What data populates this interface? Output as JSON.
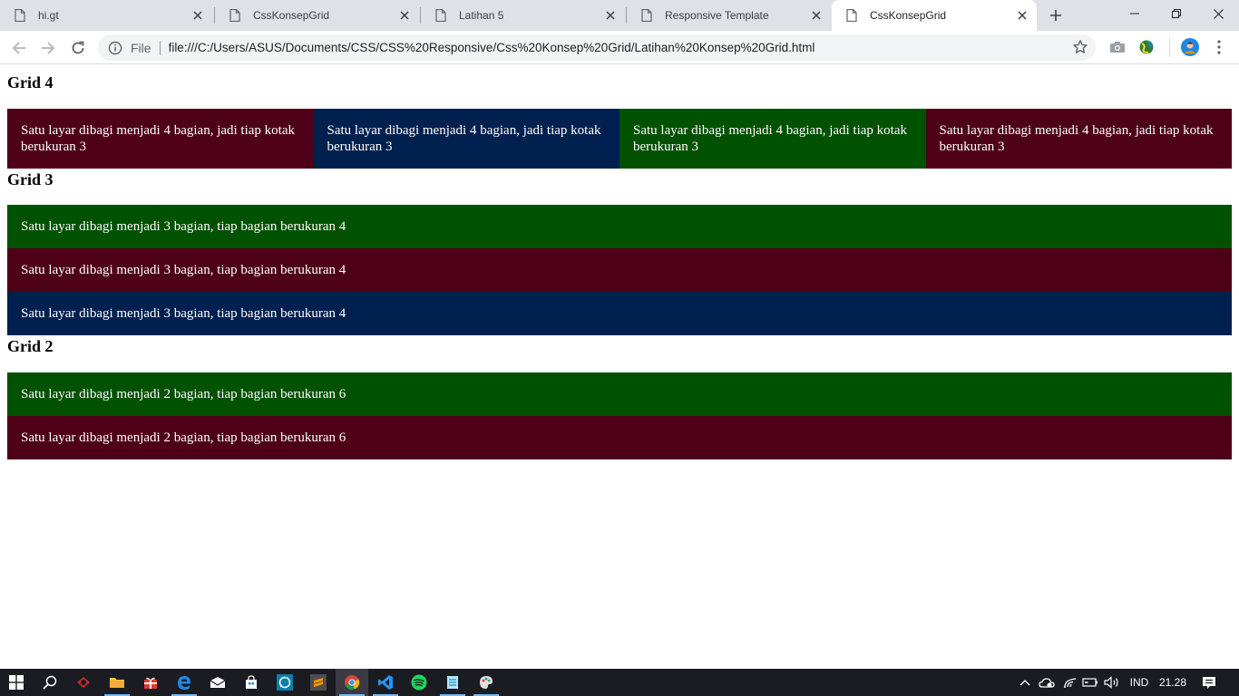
{
  "tabs": [
    {
      "label": "hi.gt",
      "active": false
    },
    {
      "label": "CssKonsepGrid",
      "active": false
    },
    {
      "label": "Latihan 5",
      "active": false
    },
    {
      "label": "Responsive Template",
      "active": false
    },
    {
      "label": "CssKonsepGrid",
      "active": true
    }
  ],
  "omnibox": {
    "scheme": "File",
    "url": "file:///C:/Users/ASUS/Documents/CSS/CSS%20Responsive/Css%20Konsep%20Grid/Latihan%20Konsep%20Grid.html"
  },
  "page": {
    "grid4": {
      "heading": "Grid 4",
      "cells": [
        {
          "text": "Satu layar dibagi menjadi 4 bagian, jadi tiap kotak berukuran 3",
          "color": "#4f0019"
        },
        {
          "text": "Satu layar dibagi menjadi 4 bagian, jadi tiap kotak berukuran 3",
          "color": "#00204f"
        },
        {
          "text": "Satu layar dibagi menjadi 4 bagian, jadi tiap kotak berukuran 3",
          "color": "#005100"
        },
        {
          "text": "Satu layar dibagi menjadi 4 bagian, jadi tiap kotak berukuran 3",
          "color": "#4f0019"
        }
      ]
    },
    "grid3": {
      "heading": "Grid 3",
      "cells": [
        {
          "text": "Satu layar dibagi menjadi 3 bagian, tiap bagian berukuran 4",
          "color": "#005100"
        },
        {
          "text": "Satu layar dibagi menjadi 3 bagian, tiap bagian berukuran 4",
          "color": "#4f0019"
        },
        {
          "text": "Satu layar dibagi menjadi 3 bagian, tiap bagian berukuran 4",
          "color": "#00204f"
        }
      ]
    },
    "grid2": {
      "heading": "Grid 2",
      "cells": [
        {
          "text": "Satu layar dibagi menjadi 2 bagian, tiap bagian berukuran 6",
          "color": "#005100"
        },
        {
          "text": "Satu layar dibagi menjadi 2 bagian, tiap bagian berukuran 6",
          "color": "#4f0019"
        }
      ]
    }
  },
  "taskbar": {
    "language": "IND",
    "time": "21.28",
    "accent": "#76b9ed"
  }
}
